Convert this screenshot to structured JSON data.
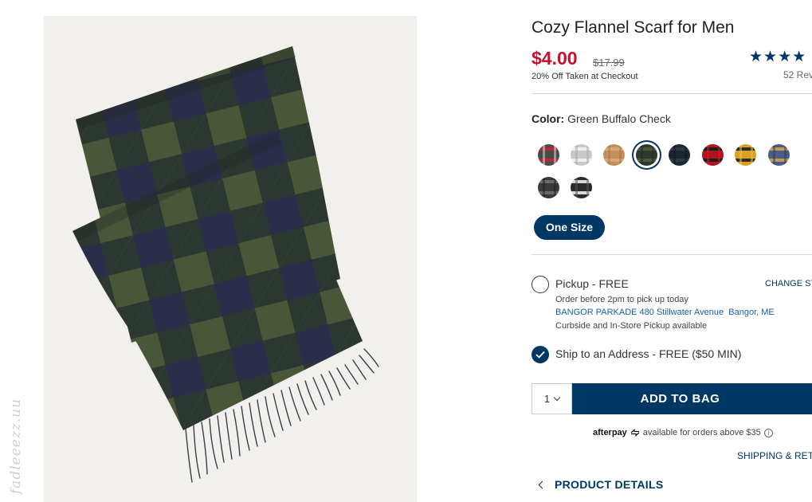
{
  "product": {
    "title": "Cozy Flannel Scarf for Men",
    "sale_price": "$4.00",
    "original_price": "$17.99",
    "discount_note": "20% Off Taken at Checkout",
    "stars": "★★★★",
    "reviews_text": "52 Rev"
  },
  "color": {
    "label": "Color:",
    "value": "Green Buffalo Check",
    "swatches": [
      {
        "name": "red-plaid",
        "colors": [
          "#4a4a4a",
          "#b22a35",
          "#dcdcdc"
        ]
      },
      {
        "name": "light-grey-plaid",
        "colors": [
          "#c9c9c9",
          "#eeeeee",
          "#a8a8a8"
        ]
      },
      {
        "name": "camel",
        "colors": [
          "#c4915c",
          "#d7a877",
          "#a77748"
        ]
      },
      {
        "name": "green-buffalo-check",
        "colors": [
          "#2f3a2b",
          "#4b5a3a",
          "#1f2a33"
        ]
      },
      {
        "name": "navy-black",
        "colors": [
          "#1d2733",
          "#2c3a48",
          "#10161e"
        ]
      },
      {
        "name": "red-buffalo-check",
        "colors": [
          "#b0141f",
          "#1c1c1c",
          "#d11f2a"
        ]
      },
      {
        "name": "yellow-plaid",
        "colors": [
          "#d9a11f",
          "#2b2b2b",
          "#f0c04a"
        ]
      },
      {
        "name": "blue-plaid",
        "colors": [
          "#4b5d86",
          "#c49a56",
          "#2f3b5c"
        ]
      },
      {
        "name": "charcoal-plaid",
        "colors": [
          "#3a3a3a",
          "#6a6a6a",
          "#222222"
        ]
      },
      {
        "name": "black-white-plaid",
        "colors": [
          "#2a2a2a",
          "#d8d8d8",
          "#555555"
        ]
      }
    ],
    "selected_index": 3
  },
  "size": {
    "selected": "One Size"
  },
  "fulfillment": {
    "pickup_label": "Pickup - FREE",
    "change_store": "CHANGE ST",
    "order_before": "Order before 2pm to pick up today",
    "store_name": "BANGOR PARKADE 480 Stillwater Avenue",
    "store_city": "Bangor, ME",
    "curbside": "Curbside and In-Store Pickup available",
    "ship_label": "Ship to an Address - FREE ($50 MIN)"
  },
  "cart": {
    "quantity": "1",
    "add_label": "ADD TO BAG"
  },
  "afterpay": {
    "logo": "afterpay",
    "text": "available for orders above $35",
    "info": "i"
  },
  "links": {
    "shipping_returns": "SHIPPING & RETU",
    "product_details": "PRODUCT DETAILS"
  },
  "watermark": "fadleeezz.uu",
  "theme": {
    "brand_navy": "#003764",
    "sale_red": "#c8102e",
    "scarf_green": "#4b5a3a",
    "scarf_navy": "#2a2f4a"
  }
}
